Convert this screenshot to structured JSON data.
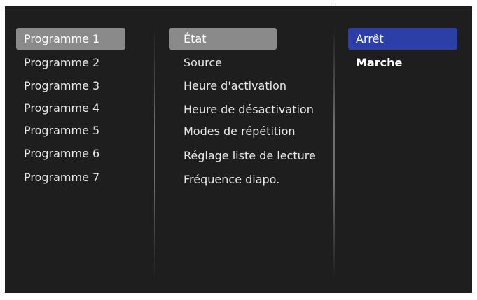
{
  "programs": {
    "items": [
      {
        "label": "Programme 1"
      },
      {
        "label": "Programme 2"
      },
      {
        "label": "Programme 3"
      },
      {
        "label": "Programme 4"
      },
      {
        "label": "Programme 5"
      },
      {
        "label": "Programme 6"
      },
      {
        "label": "Programme 7"
      }
    ]
  },
  "settings": {
    "items": [
      {
        "label": "État"
      },
      {
        "label": "Source"
      },
      {
        "label": "Heure d'activation"
      },
      {
        "label": "Heure de désactivation"
      },
      {
        "label": "Modes de répétition"
      },
      {
        "label": "Réglage liste de lecture"
      },
      {
        "label": "Fréquence diapo."
      }
    ]
  },
  "options": {
    "items": [
      {
        "label": "Arrêt"
      },
      {
        "label": "Marche"
      }
    ]
  },
  "colors": {
    "background": "#1e1e1e",
    "highlight_grey": "#8a8a8a",
    "highlight_blue": "#2c3ea8",
    "text": "#e8e8e8"
  }
}
